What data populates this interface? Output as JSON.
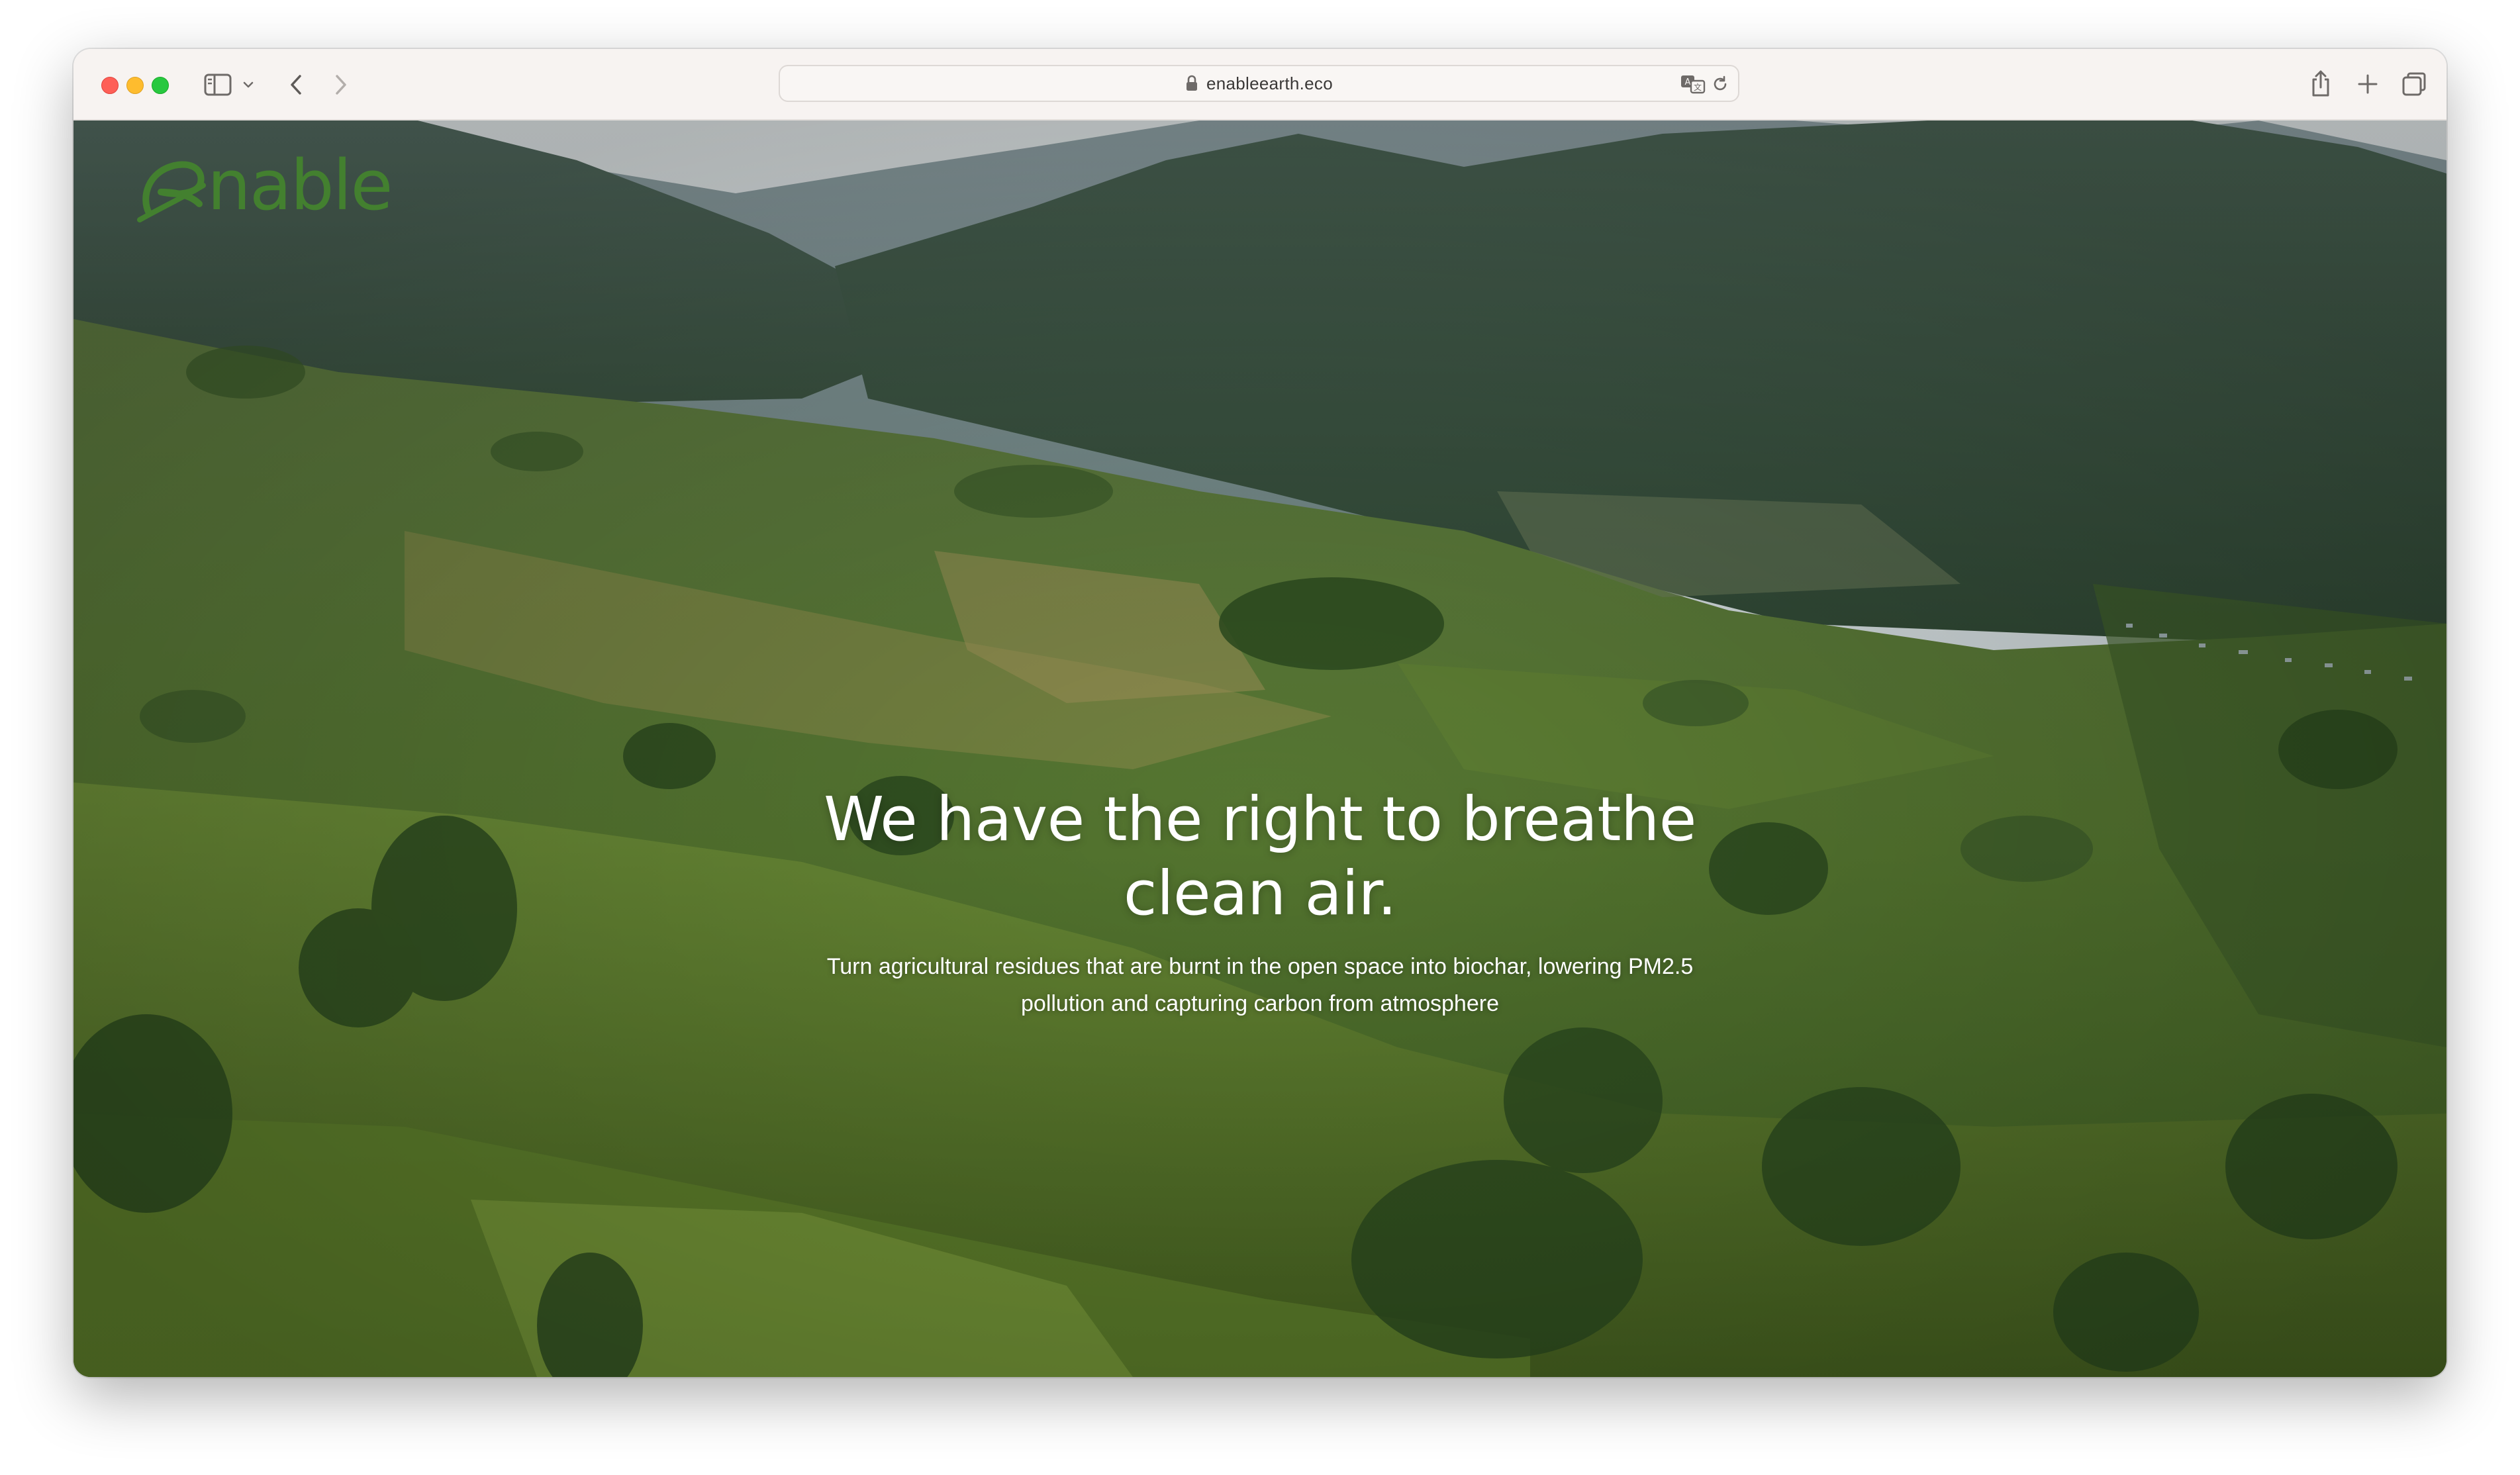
{
  "browser": {
    "url": "enableearth.eco",
    "icons": {
      "sidebar": "sidebar-icon",
      "chevron": "chevron-down-icon",
      "back": "chevron-left-icon",
      "forward": "chevron-right-icon",
      "lock": "lock-icon",
      "translate": "translate-icon",
      "reload": "reload-icon",
      "share": "share-icon",
      "new_tab": "plus-icon",
      "tabs": "tab-overview-icon"
    }
  },
  "page": {
    "logo_text": "enable",
    "hero": {
      "title_line1": "We have the right to breathe",
      "title_line2": "clean air.",
      "subtitle_line1": "Turn agricultural residues that are burnt in the open space into biochar, lowering PM2.5",
      "subtitle_line2": "pollution and capturing carbon from atmosphere"
    }
  },
  "colors": {
    "brand_green": "#3f7a2e",
    "traffic_red": "#fe5f57",
    "traffic_yellow": "#febc2e",
    "traffic_green": "#28c840"
  }
}
